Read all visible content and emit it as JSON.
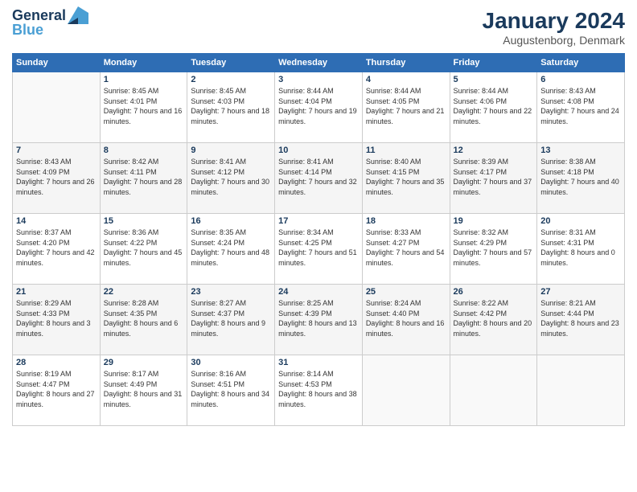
{
  "header": {
    "logo_line1": "General",
    "logo_line2": "Blue",
    "month": "January 2024",
    "location": "Augustenborg, Denmark"
  },
  "weekdays": [
    "Sunday",
    "Monday",
    "Tuesday",
    "Wednesday",
    "Thursday",
    "Friday",
    "Saturday"
  ],
  "weeks": [
    [
      {
        "day": "",
        "sunrise": "",
        "sunset": "",
        "daylight": ""
      },
      {
        "day": "1",
        "sunrise": "Sunrise: 8:45 AM",
        "sunset": "Sunset: 4:01 PM",
        "daylight": "Daylight: 7 hours and 16 minutes."
      },
      {
        "day": "2",
        "sunrise": "Sunrise: 8:45 AM",
        "sunset": "Sunset: 4:03 PM",
        "daylight": "Daylight: 7 hours and 18 minutes."
      },
      {
        "day": "3",
        "sunrise": "Sunrise: 8:44 AM",
        "sunset": "Sunset: 4:04 PM",
        "daylight": "Daylight: 7 hours and 19 minutes."
      },
      {
        "day": "4",
        "sunrise": "Sunrise: 8:44 AM",
        "sunset": "Sunset: 4:05 PM",
        "daylight": "Daylight: 7 hours and 21 minutes."
      },
      {
        "day": "5",
        "sunrise": "Sunrise: 8:44 AM",
        "sunset": "Sunset: 4:06 PM",
        "daylight": "Daylight: 7 hours and 22 minutes."
      },
      {
        "day": "6",
        "sunrise": "Sunrise: 8:43 AM",
        "sunset": "Sunset: 4:08 PM",
        "daylight": "Daylight: 7 hours and 24 minutes."
      }
    ],
    [
      {
        "day": "7",
        "sunrise": "Sunrise: 8:43 AM",
        "sunset": "Sunset: 4:09 PM",
        "daylight": "Daylight: 7 hours and 26 minutes."
      },
      {
        "day": "8",
        "sunrise": "Sunrise: 8:42 AM",
        "sunset": "Sunset: 4:11 PM",
        "daylight": "Daylight: 7 hours and 28 minutes."
      },
      {
        "day": "9",
        "sunrise": "Sunrise: 8:41 AM",
        "sunset": "Sunset: 4:12 PM",
        "daylight": "Daylight: 7 hours and 30 minutes."
      },
      {
        "day": "10",
        "sunrise": "Sunrise: 8:41 AM",
        "sunset": "Sunset: 4:14 PM",
        "daylight": "Daylight: 7 hours and 32 minutes."
      },
      {
        "day": "11",
        "sunrise": "Sunrise: 8:40 AM",
        "sunset": "Sunset: 4:15 PM",
        "daylight": "Daylight: 7 hours and 35 minutes."
      },
      {
        "day": "12",
        "sunrise": "Sunrise: 8:39 AM",
        "sunset": "Sunset: 4:17 PM",
        "daylight": "Daylight: 7 hours and 37 minutes."
      },
      {
        "day": "13",
        "sunrise": "Sunrise: 8:38 AM",
        "sunset": "Sunset: 4:18 PM",
        "daylight": "Daylight: 7 hours and 40 minutes."
      }
    ],
    [
      {
        "day": "14",
        "sunrise": "Sunrise: 8:37 AM",
        "sunset": "Sunset: 4:20 PM",
        "daylight": "Daylight: 7 hours and 42 minutes."
      },
      {
        "day": "15",
        "sunrise": "Sunrise: 8:36 AM",
        "sunset": "Sunset: 4:22 PM",
        "daylight": "Daylight: 7 hours and 45 minutes."
      },
      {
        "day": "16",
        "sunrise": "Sunrise: 8:35 AM",
        "sunset": "Sunset: 4:24 PM",
        "daylight": "Daylight: 7 hours and 48 minutes."
      },
      {
        "day": "17",
        "sunrise": "Sunrise: 8:34 AM",
        "sunset": "Sunset: 4:25 PM",
        "daylight": "Daylight: 7 hours and 51 minutes."
      },
      {
        "day": "18",
        "sunrise": "Sunrise: 8:33 AM",
        "sunset": "Sunset: 4:27 PM",
        "daylight": "Daylight: 7 hours and 54 minutes."
      },
      {
        "day": "19",
        "sunrise": "Sunrise: 8:32 AM",
        "sunset": "Sunset: 4:29 PM",
        "daylight": "Daylight: 7 hours and 57 minutes."
      },
      {
        "day": "20",
        "sunrise": "Sunrise: 8:31 AM",
        "sunset": "Sunset: 4:31 PM",
        "daylight": "Daylight: 8 hours and 0 minutes."
      }
    ],
    [
      {
        "day": "21",
        "sunrise": "Sunrise: 8:29 AM",
        "sunset": "Sunset: 4:33 PM",
        "daylight": "Daylight: 8 hours and 3 minutes."
      },
      {
        "day": "22",
        "sunrise": "Sunrise: 8:28 AM",
        "sunset": "Sunset: 4:35 PM",
        "daylight": "Daylight: 8 hours and 6 minutes."
      },
      {
        "day": "23",
        "sunrise": "Sunrise: 8:27 AM",
        "sunset": "Sunset: 4:37 PM",
        "daylight": "Daylight: 8 hours and 9 minutes."
      },
      {
        "day": "24",
        "sunrise": "Sunrise: 8:25 AM",
        "sunset": "Sunset: 4:39 PM",
        "daylight": "Daylight: 8 hours and 13 minutes."
      },
      {
        "day": "25",
        "sunrise": "Sunrise: 8:24 AM",
        "sunset": "Sunset: 4:40 PM",
        "daylight": "Daylight: 8 hours and 16 minutes."
      },
      {
        "day": "26",
        "sunrise": "Sunrise: 8:22 AM",
        "sunset": "Sunset: 4:42 PM",
        "daylight": "Daylight: 8 hours and 20 minutes."
      },
      {
        "day": "27",
        "sunrise": "Sunrise: 8:21 AM",
        "sunset": "Sunset: 4:44 PM",
        "daylight": "Daylight: 8 hours and 23 minutes."
      }
    ],
    [
      {
        "day": "28",
        "sunrise": "Sunrise: 8:19 AM",
        "sunset": "Sunset: 4:47 PM",
        "daylight": "Daylight: 8 hours and 27 minutes."
      },
      {
        "day": "29",
        "sunrise": "Sunrise: 8:17 AM",
        "sunset": "Sunset: 4:49 PM",
        "daylight": "Daylight: 8 hours and 31 minutes."
      },
      {
        "day": "30",
        "sunrise": "Sunrise: 8:16 AM",
        "sunset": "Sunset: 4:51 PM",
        "daylight": "Daylight: 8 hours and 34 minutes."
      },
      {
        "day": "31",
        "sunrise": "Sunrise: 8:14 AM",
        "sunset": "Sunset: 4:53 PM",
        "daylight": "Daylight: 8 hours and 38 minutes."
      },
      {
        "day": "",
        "sunrise": "",
        "sunset": "",
        "daylight": ""
      },
      {
        "day": "",
        "sunrise": "",
        "sunset": "",
        "daylight": ""
      },
      {
        "day": "",
        "sunrise": "",
        "sunset": "",
        "daylight": ""
      }
    ]
  ]
}
